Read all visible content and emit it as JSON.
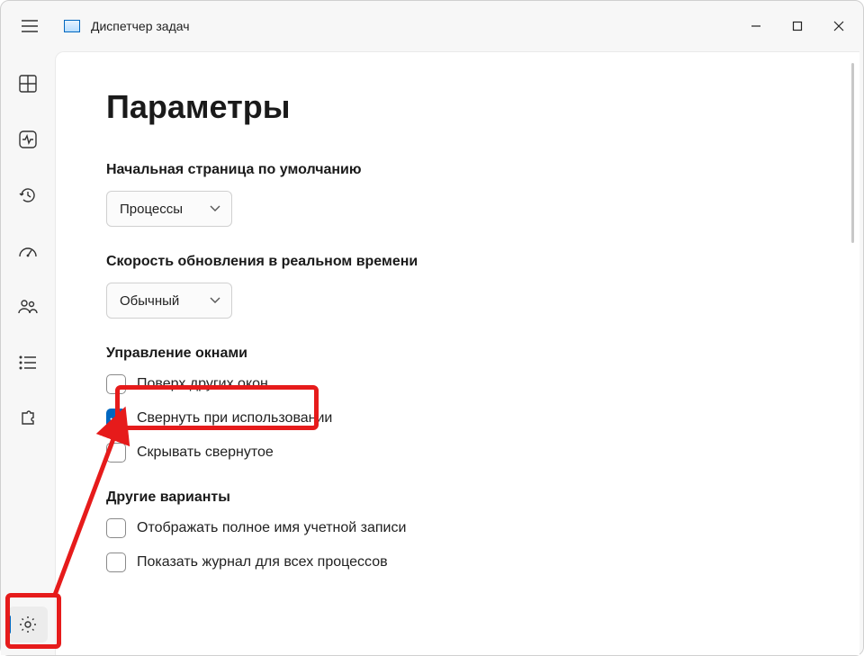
{
  "app_title": "Диспетчер задач",
  "page_title": "Параметры",
  "sections": {
    "default_page": {
      "label": "Начальная страница по умолчанию",
      "value": "Процессы"
    },
    "update_speed": {
      "label": "Скорость обновления в реальном времени",
      "value": "Обычный"
    },
    "window_mgmt": {
      "label": "Управление окнами",
      "always_on_top": "Поверх других окон",
      "minimize_on_use": "Свернуть при использовании",
      "hide_when_minimized": "Скрывать свернутое"
    },
    "other": {
      "label": "Другие варианты",
      "show_full_account_name": "Отображать полное имя учетной записи",
      "show_history_all": "Показать журнал для всех процессов"
    }
  },
  "checkbox_state": {
    "always_on_top": false,
    "minimize_on_use": true,
    "hide_when_minimized": false,
    "show_full_account_name": false,
    "show_history_all": false
  }
}
